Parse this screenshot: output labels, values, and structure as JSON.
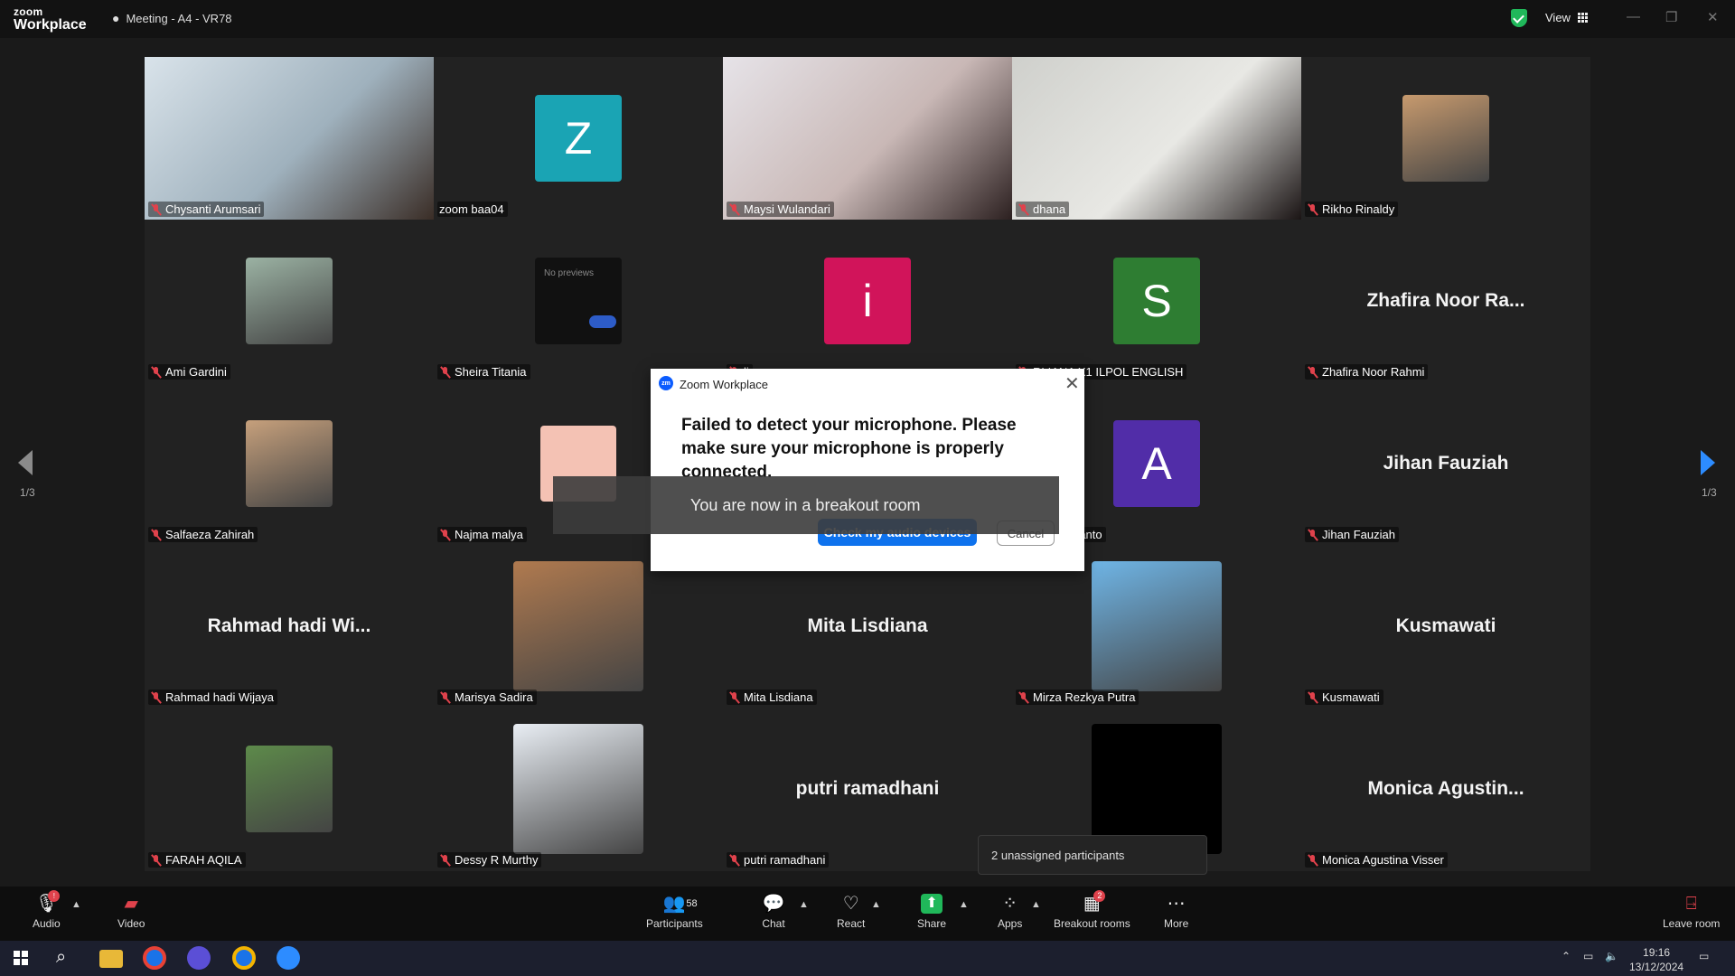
{
  "titlebar": {
    "logo_small": "zoom",
    "logo_big": "Workplace",
    "meeting_title": "Meeting - A4 - VR78",
    "view_label": "View",
    "min": "—",
    "max": "❐",
    "close": "✕"
  },
  "participants": [
    {
      "name": "Chysanti Arumsari",
      "kind": "video",
      "active": true,
      "colors": [
        "#d9e3ea",
        "#9fb1bd",
        "#3a2d26"
      ]
    },
    {
      "name": "zoom baa04",
      "kind": "initial",
      "initial": "Z",
      "color": "#1aa4b4",
      "no_mute": true
    },
    {
      "name": "Maysi Wulandari",
      "kind": "video",
      "colors": [
        "#e6e3e8",
        "#c9b8b6",
        "#2c2020"
      ]
    },
    {
      "name": "dhana",
      "kind": "video",
      "colors": [
        "#cfd0cc",
        "#e8e8e4",
        "#1a1414"
      ]
    },
    {
      "name": "Rikho Rinaldy",
      "kind": "photo",
      "color": "#c79a6e"
    },
    {
      "name": "Ami Gardini",
      "kind": "photo",
      "color": "#9bb2a3"
    },
    {
      "name": "Sheira Titania",
      "kind": "preview",
      "preview_text": "No previews"
    },
    {
      "name": "li",
      "kind": "initial",
      "initial": "i",
      "color": "#d1145a"
    },
    {
      "name": "RLIANA X1 ILPOL ENGLISH",
      "kind": "initial",
      "initial": "S",
      "color": "#2e7d32"
    },
    {
      "name": "Zhafira Noor Rahmi",
      "kind": "text",
      "display": "Zhafira  Noor  Ra..."
    },
    {
      "name": "Salfaeza Zahirah",
      "kind": "photo",
      "color": "#c6a07c"
    },
    {
      "name": "Najma malya",
      "kind": "initial",
      "initial": "",
      "color": "#f4c2b4"
    },
    {
      "name": "",
      "kind": "hidden"
    },
    {
      "name": "ung Sugianto",
      "kind": "initial",
      "initial": "A",
      "color": "#512da8"
    },
    {
      "name": "Jihan Fauziah",
      "kind": "text",
      "display": "Jihan Fauziah"
    },
    {
      "name": "Rahmad hadi Wijaya",
      "kind": "text",
      "display": "Rahmad  hadi  Wi..."
    },
    {
      "name": "Marisya Sadira",
      "kind": "photo",
      "color": "#b07a4f",
      "large": true
    },
    {
      "name": "Mita Lisdiana",
      "kind": "text",
      "display": "Mita Lisdiana"
    },
    {
      "name": "Mirza Rezkya Putra",
      "kind": "photo",
      "color": "#6fb5e6",
      "large": true
    },
    {
      "name": "Kusmawati",
      "kind": "text",
      "display": "Kusmawati"
    },
    {
      "name": "FARAH AQILA",
      "kind": "photo",
      "color": "#5d8a4a"
    },
    {
      "name": "Dessy R Murthy",
      "kind": "photo",
      "color": "#e9eef4",
      "large": true
    },
    {
      "name": "putri ramadhani",
      "kind": "text",
      "display": "putri ramadhani"
    },
    {
      "name": "",
      "kind": "black",
      "large": true
    },
    {
      "name": "Monica Agustina Visser",
      "kind": "text",
      "display": "Monica  Agustin..."
    }
  ],
  "pager": {
    "left": "1/3",
    "right": "1/3"
  },
  "dialog": {
    "title": "Zoom Workplace",
    "zm": "zm",
    "message": "Failed to detect your microphone. Please make sure your microphone is properly connected.",
    "primary": "Check my audio devices",
    "cancel": "Cancel",
    "close": "✕"
  },
  "toast": {
    "text": "You are now in a breakout room"
  },
  "unassigned": {
    "text": "2 unassigned participants"
  },
  "toolbar": {
    "audio": "Audio",
    "video": "Video",
    "participants": "Participants",
    "participants_count": "58",
    "chat": "Chat",
    "react": "React",
    "share": "Share",
    "apps": "Apps",
    "breakout": "Breakout rooms",
    "breakout_badge": "2",
    "more": "More",
    "leave": "Leave room"
  },
  "taskbar": {
    "time": "19:16",
    "date": "13/12/2024"
  }
}
